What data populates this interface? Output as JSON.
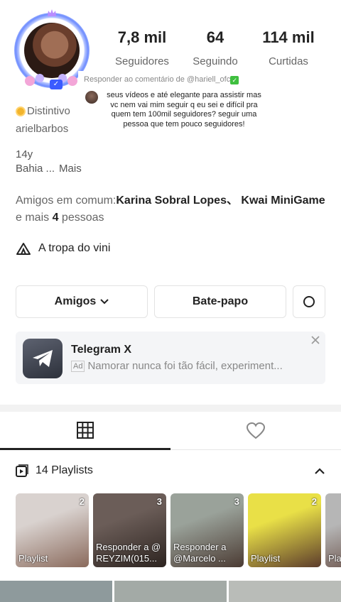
{
  "stats": {
    "followers": {
      "value": "7,8 mil",
      "label": "Seguidores"
    },
    "following": {
      "value": "64",
      "label": "Seguindo"
    },
    "likes": {
      "value": "114 mil",
      "label": "Curtidas"
    }
  },
  "comment_popup": {
    "header": "Responder ao comentário de @hariell_ofc",
    "text": "seus vídeos e até elegante para assistir mas vc nem vai mim seguir q eu sei e difícil pra quem tem 100mil seguidores? seguir uma pessoa que tem pouco seguidores!"
  },
  "profile": {
    "distinction": "Distintivo",
    "username": "arielbarbos",
    "age": "14y",
    "location": "Bahia ...",
    "more": "Mais"
  },
  "mutual": {
    "prefix": "Amigos em comum:",
    "names": "Karina Sobral Lopes、 Kwai MiniGame",
    "suffix_a": "e mais ",
    "count": "4",
    "suffix_b": " pessoas"
  },
  "group": {
    "label": "A tropa do vini",
    "icon": "tent-icon"
  },
  "buttons": {
    "friends": "Amigos",
    "chat": "Bate-papo"
  },
  "ad": {
    "title": "Telegram X",
    "tag": "Ad",
    "text": "Namorar nunca foi tão fácil, experiment..."
  },
  "playlists": {
    "header": "14 Playlists",
    "items": [
      {
        "label": "Playlist",
        "count": "2",
        "colors": [
          "#d9d2cf",
          "#8a6a5c"
        ]
      },
      {
        "label": "Responder a @ REYZIM(015...",
        "count": "3",
        "colors": [
          "#6b5d58",
          "#2d2420"
        ]
      },
      {
        "label": "Responder a @Marcelo ...",
        "count": "3",
        "colors": [
          "#9aa29a",
          "#4b3b33"
        ]
      },
      {
        "label": "Playlist",
        "count": "2",
        "colors": [
          "#e9e047",
          "#5c3c2c"
        ]
      },
      {
        "label": "Pla",
        "count": "",
        "colors": [
          "#b6b6b6",
          "#5d4036"
        ]
      }
    ]
  }
}
